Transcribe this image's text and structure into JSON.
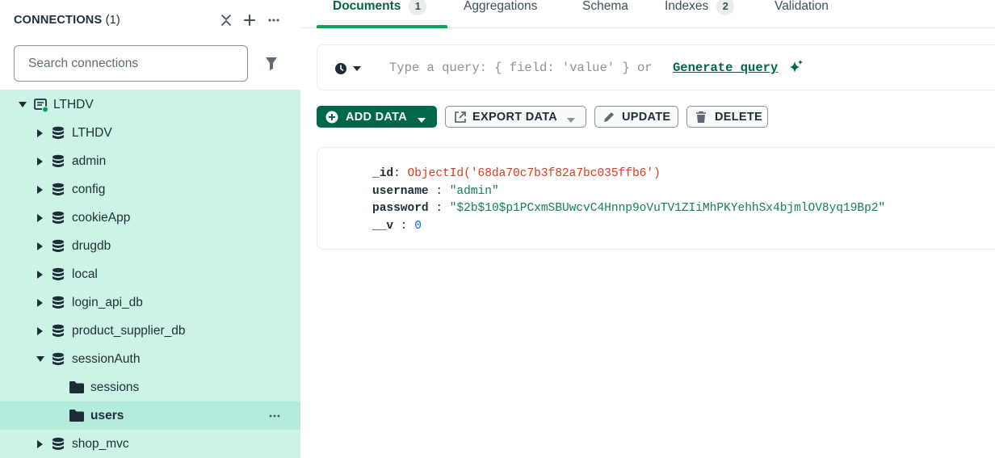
{
  "sidebar": {
    "title": "CONNECTIONS",
    "count": "(1)",
    "search_placeholder": "Search connections",
    "connection": {
      "label": "LTHDV"
    },
    "databases": [
      {
        "label": "LTHDV"
      },
      {
        "label": "admin"
      },
      {
        "label": "config"
      },
      {
        "label": "cookieApp"
      },
      {
        "label": "drugdb"
      },
      {
        "label": "local"
      },
      {
        "label": "login_api_db"
      },
      {
        "label": "product_supplier_db"
      },
      {
        "label": "sessionAuth"
      },
      {
        "label": "shop_mvc"
      }
    ],
    "collections": [
      {
        "label": "sessions"
      },
      {
        "label": "users"
      }
    ]
  },
  "tabs": [
    {
      "label": "Documents",
      "badge": "1"
    },
    {
      "label": "Aggregations"
    },
    {
      "label": "Schema"
    },
    {
      "label": "Indexes",
      "badge": "2"
    },
    {
      "label": "Validation"
    }
  ],
  "querybar": {
    "placeholder": "Type a query: { field: 'value' } or",
    "generate_label": "Generate query"
  },
  "toolbar": {
    "add_data": "ADD DATA",
    "export_data": "EXPORT DATA",
    "update": "UPDATE",
    "delete": "DELETE"
  },
  "document": [
    {
      "key": "_id",
      "value": "ObjectId('68da70c7b3f82a7bc035ffb6')",
      "kind": "oid"
    },
    {
      "key": "username",
      "value": "\"admin\"",
      "kind": "str"
    },
    {
      "key": "password",
      "value": "\"$2b$10$p1PCxmSBUwcvC4Hnnp9oVuTV1ZIiMhPKYehhSx4bjmlOV8yq19Bp2\"",
      "kind": "str"
    },
    {
      "key": "__v",
      "value": "0",
      "kind": "num"
    }
  ],
  "colors": {
    "accent": "#00684a",
    "sidebar_bg": "#cdf3e7",
    "selected_bg": "#b5ebdc",
    "tab_active": "#016646",
    "tab_underline": "#00a35c"
  }
}
